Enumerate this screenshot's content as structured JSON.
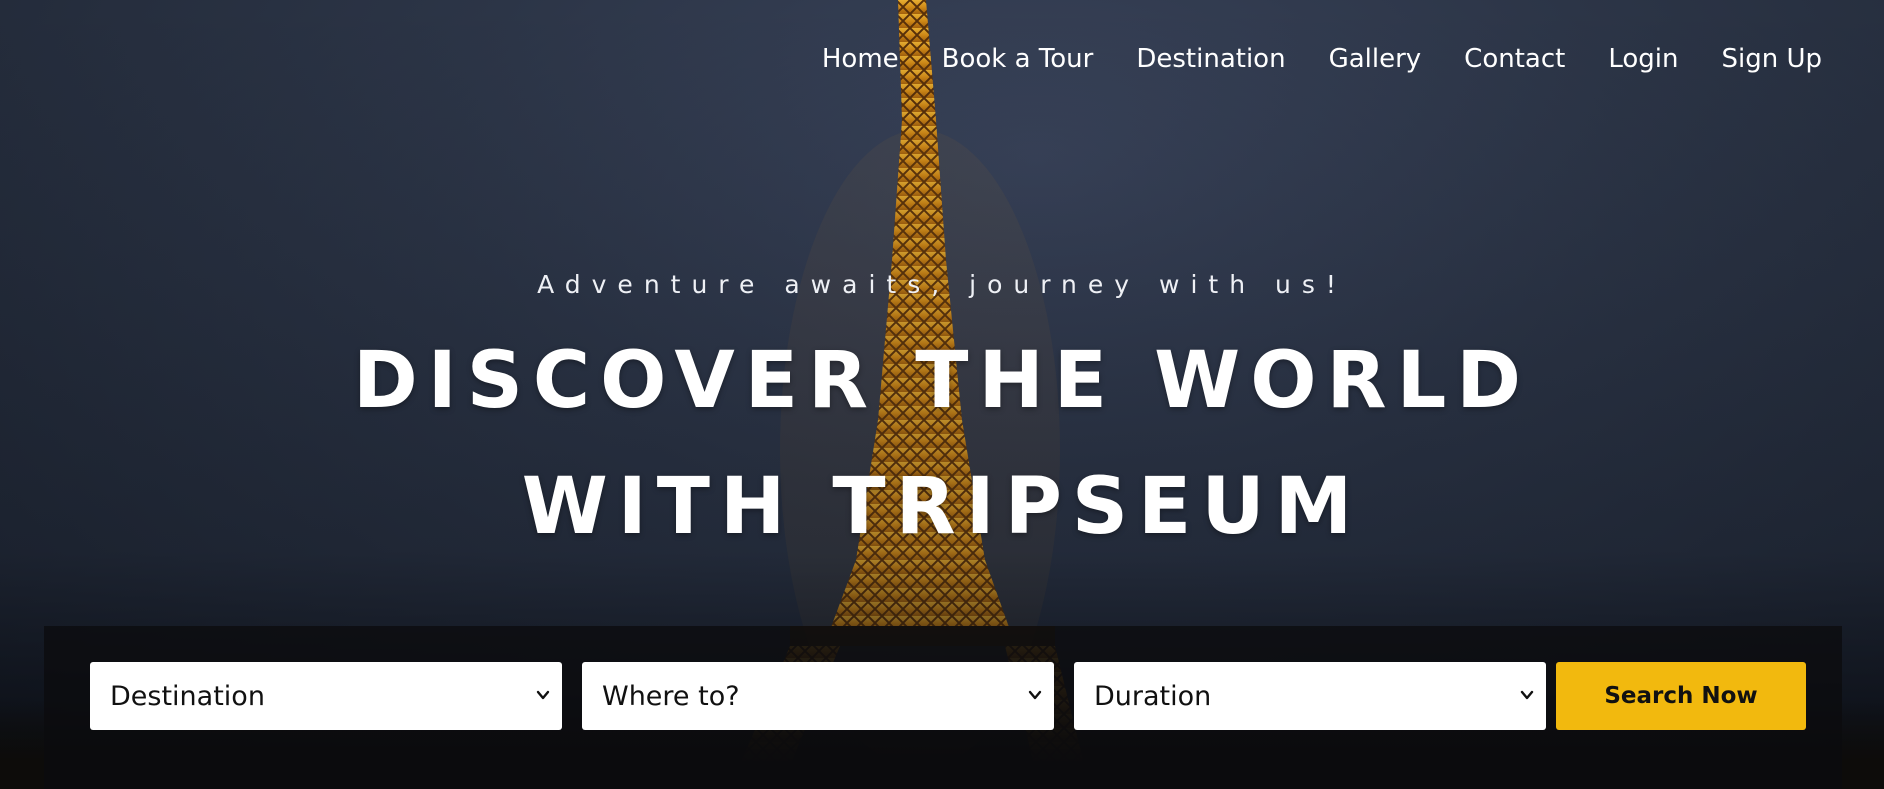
{
  "nav": {
    "items": [
      {
        "label": "Home"
      },
      {
        "label": "Book a Tour"
      },
      {
        "label": "Destination"
      },
      {
        "label": "Gallery"
      },
      {
        "label": "Contact"
      },
      {
        "label": "Login"
      },
      {
        "label": "Sign Up"
      }
    ]
  },
  "hero": {
    "tagline": "Adventure awaits, journey with us!",
    "headline_line1": "DISCOVER THE WORLD",
    "headline_line2": "WITH TRIPSEUM"
  },
  "search": {
    "destination_value": "Destination",
    "where_value": "Where to?",
    "duration_value": "Duration",
    "button_label": "Search Now"
  },
  "colors": {
    "accent": "#f2b90e",
    "tower_light": "#e8a21a"
  }
}
